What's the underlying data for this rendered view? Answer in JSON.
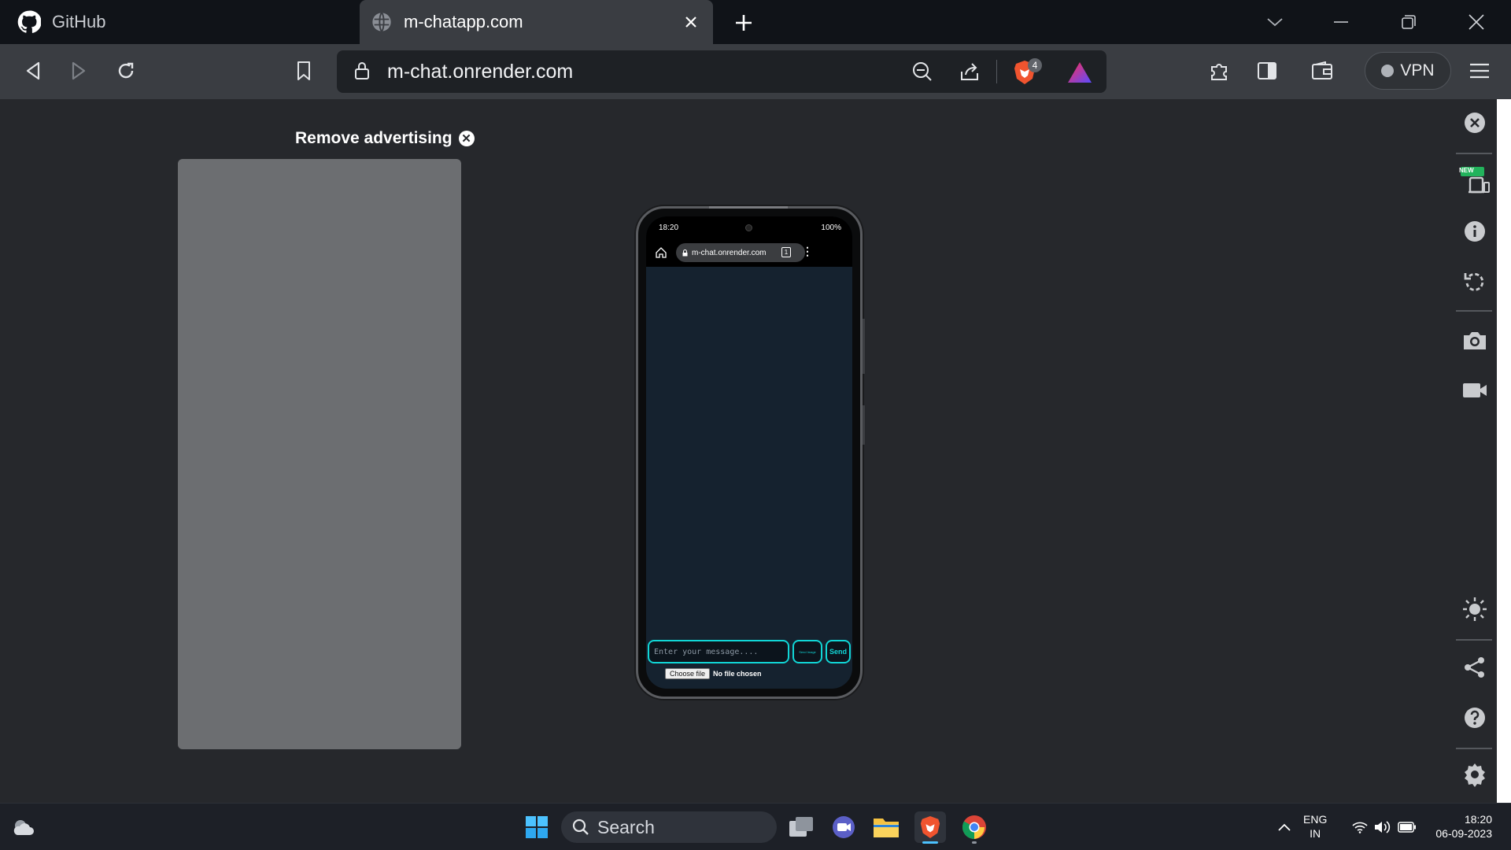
{
  "browser": {
    "tabs": [
      {
        "label": "GitHub",
        "icon": "github-icon",
        "active": false
      },
      {
        "label": "m-chatapp.com",
        "icon": "globe-icon",
        "active": true
      }
    ],
    "new_tab_label": "+",
    "address": "m-chat.onrender.com",
    "shields_count": "4",
    "vpn_label": "VPN"
  },
  "page": {
    "remove_ad_label": "Remove advertising",
    "phone": {
      "status_time": "18:20",
      "battery": "100%",
      "url": "m-chat.onrender.com",
      "tab_count": "1",
      "message_placeholder": "Enter your message....",
      "send_image_label": "Send Image",
      "send_label": "Send",
      "choose_file_label": "Choose file",
      "file_status": "No file chosen"
    }
  },
  "sidebar_tools": [
    "close-icon",
    "devices-icon",
    "info-icon",
    "rotate-icon",
    "camera-icon",
    "video-icon",
    "brightness-icon",
    "share-icon",
    "help-icon",
    "settings-icon"
  ],
  "sidebar_new_badge": "NEW",
  "taskbar": {
    "search_label": "Search",
    "lang_line1": "ENG",
    "lang_line2": "IN",
    "time": "18:20",
    "date": "06-09-2023"
  },
  "colors": {
    "accent_cyan": "#11d6d6",
    "tab_strip": "#101318",
    "toolbar": "#3a3d42",
    "content_bg": "#26282c",
    "ad_placeholder": "#6c6e71"
  }
}
